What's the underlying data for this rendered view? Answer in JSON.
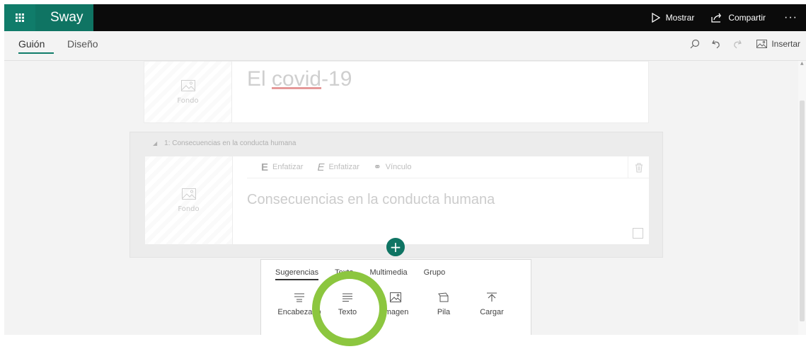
{
  "app": {
    "name": "Sway",
    "accent": "#107c6a",
    "highlight_color": "#8cc63f"
  },
  "topbar": {
    "actions": [
      {
        "label": "Mostrar",
        "icon": "play-icon"
      },
      {
        "label": "Compartir",
        "icon": "share-icon"
      }
    ],
    "more": "···"
  },
  "toolbar": {
    "tabs": [
      {
        "label": "Guión",
        "active": true
      },
      {
        "label": "Diseño",
        "active": false
      }
    ],
    "tools": [
      "search-icon",
      "undo-icon",
      "redo-icon"
    ],
    "insert_label": "Insertar"
  },
  "storyline": {
    "title_card": {
      "background_label": "Fondo",
      "title_prefix": "El ",
      "title_typo": "covid",
      "title_suffix": "-19"
    },
    "section": {
      "header": "1: Consecuencias en la conducta humana",
      "format_bar": [
        {
          "glyph": "E",
          "label": "Enfatizar"
        },
        {
          "glyph": "E",
          "label": "Enfatizar"
        },
        {
          "glyph": "⚭",
          "label": "Vínculo"
        }
      ],
      "background_label": "Fondo",
      "heading_text": "Consecuencias en la conducta humana"
    }
  },
  "insert_popup": {
    "tabs": [
      {
        "label": "Sugerencias",
        "active": true
      },
      {
        "label": "Texto",
        "active": false
      },
      {
        "label": "Multimedia",
        "active": false
      },
      {
        "label": "Grupo",
        "active": false
      }
    ],
    "items": [
      {
        "label": "Encabezado",
        "icon": "heading-icon"
      },
      {
        "label": "Texto",
        "icon": "text-icon"
      },
      {
        "label": "Imagen",
        "icon": "image-icon"
      },
      {
        "label": "Pila",
        "icon": "stack-icon"
      },
      {
        "label": "Cargar",
        "icon": "upload-icon"
      }
    ]
  }
}
